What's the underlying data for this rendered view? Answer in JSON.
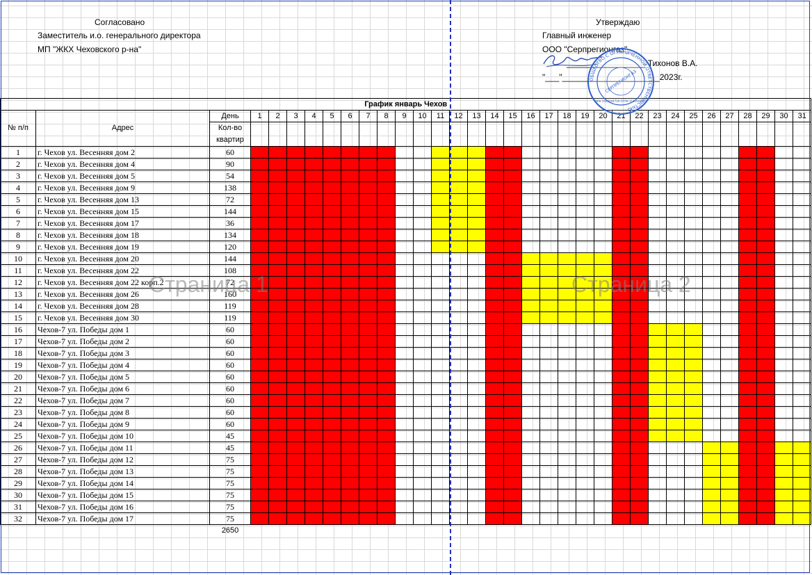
{
  "approval": {
    "left_title": "Согласовано",
    "left_line1": "Заместитель и.о. генерального директора",
    "left_line2": "МП \"ЖКХ Чеховского р-на\"",
    "right_title": "Утверждаю",
    "right_line1": "Главный инженер",
    "right_line2": "ООО \"Серпрегионгаз\"",
    "right_sign_line": "_________________  Тихонов В.А.",
    "right_date_line": "\"___\"_____________________2023г."
  },
  "schedule": {
    "title": "График январь Чехов",
    "col_no": "№ п/п",
    "col_address": "Адрес",
    "col_day": "День",
    "col_qty": "Кол-во квартир",
    "days": [
      "1",
      "2",
      "3",
      "4",
      "5",
      "6",
      "7",
      "8",
      "9",
      "10",
      "11",
      "12",
      "13",
      "14",
      "15",
      "16",
      "17",
      "18",
      "19",
      "20",
      "21",
      "22",
      "23",
      "24",
      "25",
      "26",
      "27",
      "28",
      "29",
      "30",
      "31"
    ],
    "rows": [
      {
        "no": "1",
        "address": "г. Чехов ул. Весенняя дом 2",
        "qty": "60"
      },
      {
        "no": "2",
        "address": "г. Чехов ул. Весенняя дом 4",
        "qty": "90"
      },
      {
        "no": "3",
        "address": "г. Чехов ул. Весенняя дом 5",
        "qty": "54"
      },
      {
        "no": "4",
        "address": "г. Чехов ул. Весенняя дом 9",
        "qty": "138"
      },
      {
        "no": "5",
        "address": "г. Чехов ул. Весенняя дом 13",
        "qty": "72"
      },
      {
        "no": "6",
        "address": "г. Чехов ул. Весенняя дом 15",
        "qty": "144"
      },
      {
        "no": "7",
        "address": "г. Чехов ул. Весенняя дом 17",
        "qty": "36"
      },
      {
        "no": "8",
        "address": "г. Чехов ул. Весенняя дом 18",
        "qty": "134"
      },
      {
        "no": "9",
        "address": "г. Чехов ул. Весенняя дом 19",
        "qty": "120"
      },
      {
        "no": "10",
        "address": "г. Чехов ул. Весенняя дом 20",
        "qty": "144"
      },
      {
        "no": "11",
        "address": "г. Чехов ул. Весенняя дом 22",
        "qty": "108"
      },
      {
        "no": "12",
        "address": "г. Чехов ул. Весенняя дом 22 корп.2",
        "qty": "72"
      },
      {
        "no": "13",
        "address": "г. Чехов ул. Весенняя дом 26",
        "qty": "160"
      },
      {
        "no": "14",
        "address": "г. Чехов ул. Весенняя дом 28",
        "qty": "119"
      },
      {
        "no": "15",
        "address": "г. Чехов ул. Весенняя дом 30",
        "qty": "119"
      },
      {
        "no": "16",
        "address": "Чехов-7 ул. Победы дом 1",
        "qty": "60"
      },
      {
        "no": "17",
        "address": "Чехов-7 ул. Победы дом 2",
        "qty": "60"
      },
      {
        "no": "18",
        "address": "Чехов-7 ул. Победы дом 3",
        "qty": "60"
      },
      {
        "no": "19",
        "address": "Чехов-7 ул. Победы дом 4",
        "qty": "60"
      },
      {
        "no": "20",
        "address": "Чехов-7 ул. Победы дом 5",
        "qty": "60"
      },
      {
        "no": "21",
        "address": "Чехов-7 ул. Победы дом 6",
        "qty": "60"
      },
      {
        "no": "22",
        "address": "Чехов-7 ул. Победы дом 7",
        "qty": "60"
      },
      {
        "no": "23",
        "address": "Чехов-7 ул. Победы дом 8",
        "qty": "60"
      },
      {
        "no": "24",
        "address": "Чехов-7 ул. Победы дом 9",
        "qty": "60"
      },
      {
        "no": "25",
        "address": "Чехов-7 ул. Победы дом 10",
        "qty": "45"
      },
      {
        "no": "26",
        "address": "Чехов-7 ул. Победы дом 11",
        "qty": "45"
      },
      {
        "no": "27",
        "address": "Чехов-7 ул. Победы дом 12",
        "qty": "75"
      },
      {
        "no": "28",
        "address": "Чехов-7 ул. Победы дом 13",
        "qty": "75"
      },
      {
        "no": "29",
        "address": "Чехов-7 ул. Победы дом 14",
        "qty": "75"
      },
      {
        "no": "30",
        "address": "Чехов-7 ул. Победы дом 15",
        "qty": "75"
      },
      {
        "no": "31",
        "address": "Чехов-7 ул. Победы дом 16",
        "qty": "75"
      },
      {
        "no": "32",
        "address": "Чехов-7 ул. Победы дом 17",
        "qty": "75"
      }
    ],
    "total": "2650",
    "red_days_all_rows": [
      1,
      2,
      3,
      4,
      5,
      6,
      7,
      8,
      14,
      15,
      21,
      22,
      28,
      29
    ],
    "yellow_blocks": [
      {
        "rows_from": 1,
        "rows_to": 9,
        "days": [
          11,
          12,
          13
        ]
      },
      {
        "rows_from": 10,
        "rows_to": 15,
        "days": [
          16,
          17,
          18,
          19,
          20
        ]
      },
      {
        "rows_from": 16,
        "rows_to": 25,
        "days": [
          23,
          24,
          25
        ]
      },
      {
        "rows_from": 26,
        "rows_to": 32,
        "days": [
          26,
          27,
          30,
          31
        ]
      }
    ]
  },
  "watermarks": {
    "page1": "Страница 1",
    "page2": "Страница 2"
  },
  "stamp": {
    "inner_text": "СЕРПРЕГИОНГАЗ",
    "ring_text": "ОБЩЕСТВО С ОГРАНИЧЕННОЙ ОТВЕТСТВЕННОСТЬЮ",
    "inn_text": "ИНН 5043044729 ОГРН 1115043003"
  },
  "colors": {
    "scheduled_red": "#ff0000",
    "scheduled_yellow": "#ffff00",
    "page_break_blue": "#1f2fb8",
    "stamp_blue": "#2f5fc8"
  }
}
